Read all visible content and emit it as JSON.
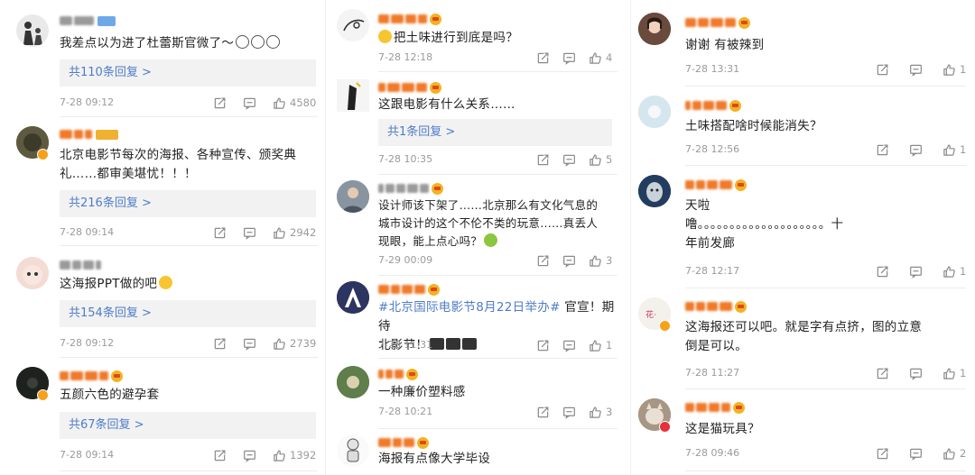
{
  "columns": [
    {
      "comments": [
        {
          "text": "我差点以为进了杜蕾斯官微了～",
          "reply": "共110条回复 >",
          "time": "7-28 09:12",
          "likes": "4580"
        },
        {
          "text_lines": [
            "北京电影节每次的海报、各种宣传、颁奖典",
            "礼……都审美堪忧！！！"
          ],
          "reply": "共216条回复 >",
          "time": "7-28 09:14",
          "likes": "2942"
        },
        {
          "text": "这海报PPT做的吧",
          "reply": "共154条回复 >",
          "time": "7-28 09:12",
          "likes": "2739"
        },
        {
          "text": "五颜六色的避孕套",
          "reply": "共67条回复 >",
          "time": "7-28 09:14",
          "likes": "1392"
        }
      ]
    },
    {
      "comments": [
        {
          "text": "把土味进行到底是吗？",
          "time": "7-28 12:18",
          "likes": "4"
        },
        {
          "text": "这跟电影有什么关系……",
          "reply": "共1条回复 >",
          "time": "7-28 10:35",
          "likes": "5"
        },
        {
          "text_lines": [
            "设计师该下架了……北京那么有文化气息的",
            "城市设计的这个不伦不类的玩意……真丢人",
            "现眼，能上点心吗？"
          ],
          "time": "7-29 00:09",
          "likes": "3"
        },
        {
          "hashtag": "#北京国际电影节8月22日举办#",
          "text_after": " 官宣！期待",
          "text_line2": "北影节！",
          "time": "7-28 11:31",
          "likes": "1"
        },
        {
          "text": "一种廉价塑料感",
          "time": "7-28 10:21",
          "likes": "3"
        },
        {
          "text": "海报有点像大学毕设"
        }
      ]
    },
    {
      "comments": [
        {
          "text": "谢谢 有被辣到",
          "time": "7-28 13:31",
          "likes": "1"
        },
        {
          "text": "土味搭配啥时候能消失？",
          "time": "7-28 12:56",
          "likes": "1"
        },
        {
          "text_lines": [
            "天啦",
            "噜。。。。。。。。。。。。。。。。。。。。十",
            "年前发廊"
          ],
          "time": "7-28 12:17",
          "likes": "1"
        },
        {
          "text_lines": [
            "这海报还可以吧。就是字有点挤，图的立意",
            "倒是可以。"
          ],
          "time": "7-28 11:27",
          "likes": "1"
        },
        {
          "text": "这是猫玩具？",
          "time": "7-28 09:46",
          "likes": "2"
        }
      ]
    }
  ],
  "colors": {
    "link": "#4f7cc7",
    "meta": "#9a9a9a",
    "reply_bg": "#f2f2f2"
  }
}
